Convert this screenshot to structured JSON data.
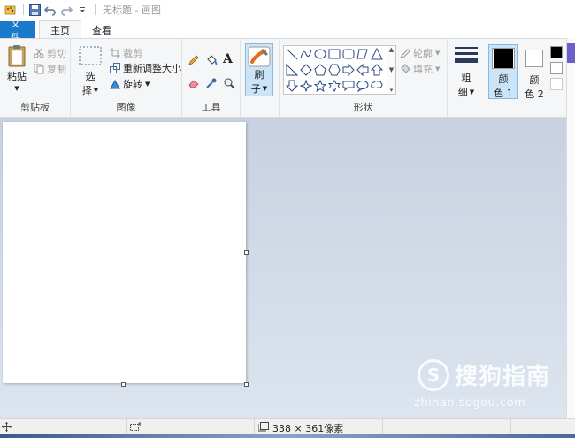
{
  "window": {
    "title": "无标题 - 画图"
  },
  "tabs": [
    {
      "label": "文件"
    },
    {
      "label": "主页"
    },
    {
      "label": "查看"
    }
  ],
  "ribbon": {
    "clipboard": {
      "label": "剪贴板",
      "paste": "粘贴",
      "cut": "剪切",
      "copy": "复制"
    },
    "image": {
      "label": "图像",
      "select_top": "选",
      "select_bottom": "择",
      "crop": "裁剪",
      "resize": "重新调整大小",
      "rotate": "旋转"
    },
    "tools": {
      "label": "工具"
    },
    "brushes": {
      "top": "刷",
      "bottom": "子"
    },
    "shapes": {
      "label": "形状",
      "outline": "轮廓",
      "fill": "填充"
    },
    "size": {
      "top": "粗",
      "bottom": "细"
    },
    "color1": {
      "top": "颜",
      "bottom": "色 1",
      "value": "#000000"
    },
    "color2": {
      "top": "颜",
      "bottom": "色 2",
      "value": "#ffffff"
    }
  },
  "statusbar": {
    "canvas_size": "338 × 361像素"
  },
  "watermark": {
    "brand": "搜狗指南",
    "url": "zhinan.sogou.com"
  },
  "colors": {
    "accent": "#1979ca",
    "selected_bg": "#cce4f7"
  }
}
